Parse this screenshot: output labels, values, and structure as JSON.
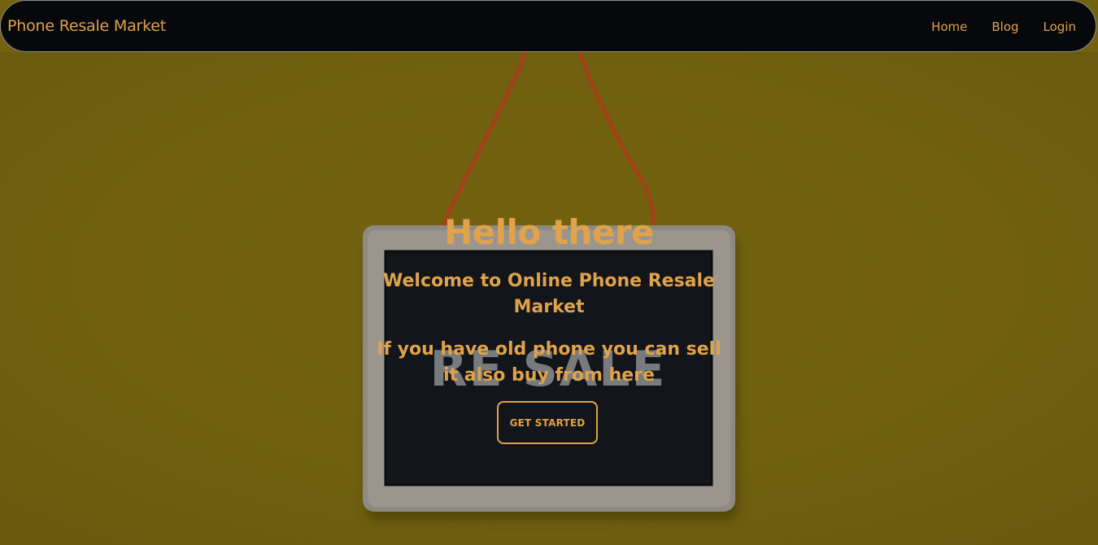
{
  "navbar": {
    "brand": "Phone Resale Market",
    "links": [
      "Home",
      "Blog",
      "Login"
    ]
  },
  "hero": {
    "background_image": {
      "sign_text": "RE SALE"
    },
    "title": "Hello there",
    "subtitle": "Welcome to Online Phone Resale Market",
    "text": "If you have old phone you can sell it also buy from here",
    "cta_label": "GET STARTED"
  },
  "colors": {
    "accent": "#e0a24b",
    "navbar_bg": "#07080b",
    "hero_bg": "#726210",
    "board": "#12151a",
    "frame": "#8d8a83"
  }
}
